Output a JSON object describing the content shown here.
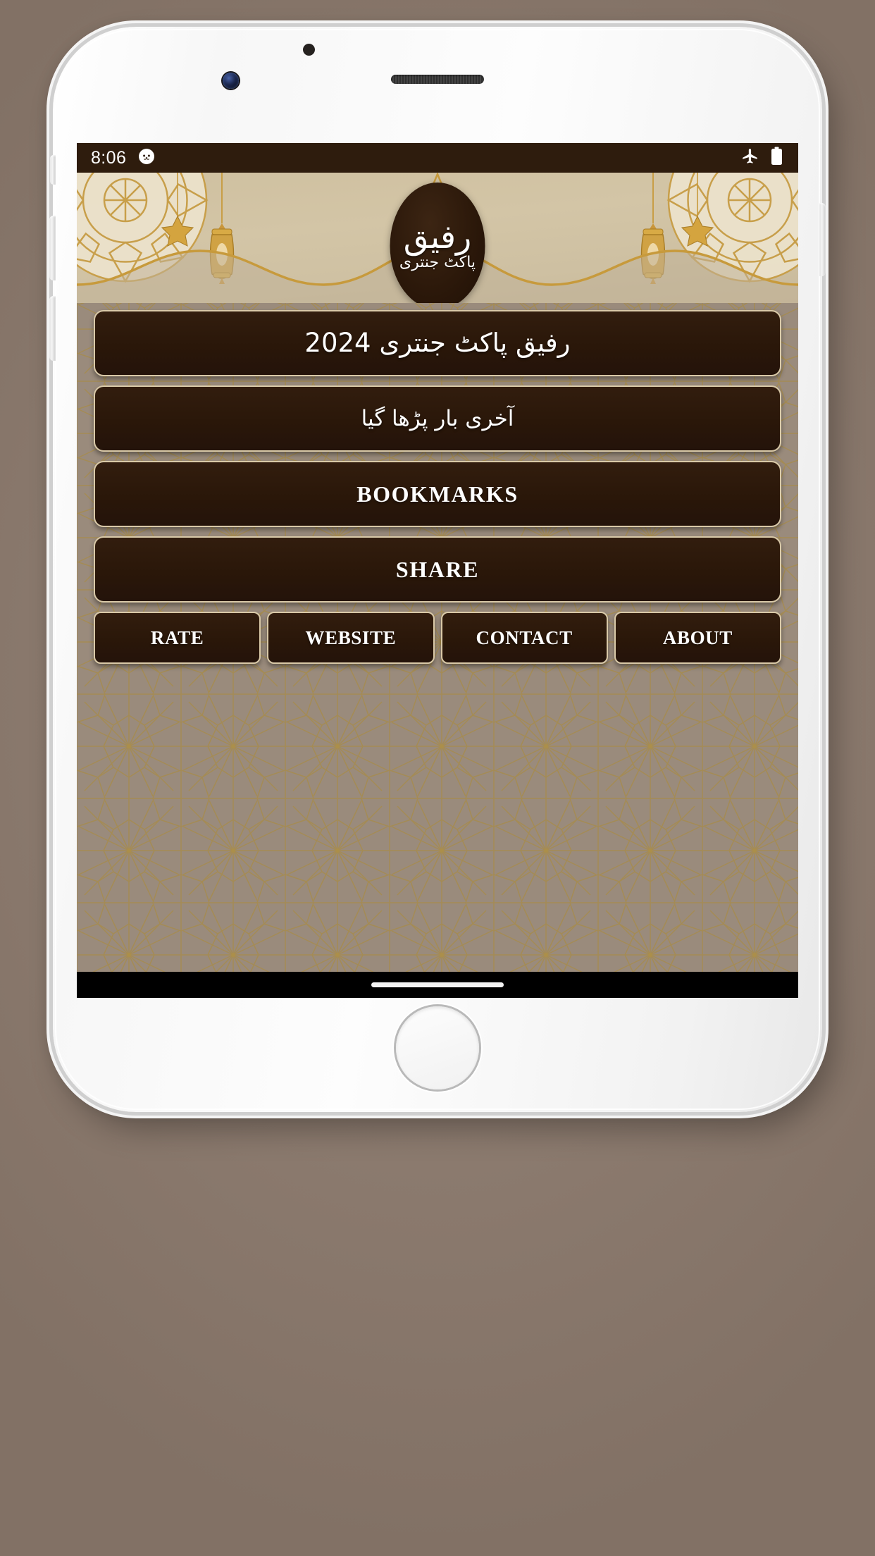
{
  "device": {
    "type": "white-iphone-mockup",
    "hardware": {
      "earpiece": "earpiece-speaker",
      "front_camera": "front-camera",
      "proximity_sensor": "proximity-sensor",
      "home_button": "home-button",
      "silent_switch": "silent-switch",
      "volume_up": "volume-up-button",
      "volume_down": "volume-down-button",
      "power": "power-button"
    },
    "backdrop_color": "#8d7c70"
  },
  "status_bar": {
    "time": "8:06",
    "background_color": "#2e1c0d",
    "left_icons": [
      {
        "name": "cat-face-notification-icon",
        "glyph": "cat"
      }
    ],
    "right_icons": [
      {
        "name": "airplane-mode-icon",
        "glyph": "airplane"
      },
      {
        "name": "battery-full-icon",
        "glyph": "battery"
      }
    ]
  },
  "banner": {
    "background_color": "#d0c2a3",
    "accent_gold": "#c99a3a",
    "logo": {
      "title_main": "رفیق",
      "title_sub": "پاکٹ جنتری",
      "badge_color": "#2a1709"
    },
    "ornaments": [
      "mandala-left",
      "mandala-right",
      "lantern-left",
      "lantern-right",
      "hanging-star-left",
      "hanging-star-right",
      "gold-wave-line"
    ]
  },
  "theme": {
    "button_fill": "#2a1709",
    "button_border": "#d9c9a8",
    "button_text": "#ffffff",
    "page_background": "#9a8b7c",
    "pattern_line": "#b2913f"
  },
  "menu": {
    "primary": [
      {
        "name": "jantri-2024-button",
        "label": "رفیق پاکٹ جنتری 2024",
        "script": "urdu"
      },
      {
        "name": "last-read-button",
        "label": "آخری بار پڑھا گیا",
        "script": "urdu"
      },
      {
        "name": "bookmarks-button",
        "label": "BOOKMARKS",
        "script": "latin"
      },
      {
        "name": "share-button",
        "label": "SHARE",
        "script": "latin"
      }
    ],
    "secondary": [
      {
        "name": "rate-button",
        "label": "RATE"
      },
      {
        "name": "website-button",
        "label": "WEBSITE"
      },
      {
        "name": "contact-button",
        "label": "CONTACT"
      },
      {
        "name": "about-button",
        "label": "ABOUT"
      }
    ]
  },
  "nav_bar": {
    "gesture_pill": "home-gesture-pill",
    "background_color": "#000000"
  }
}
